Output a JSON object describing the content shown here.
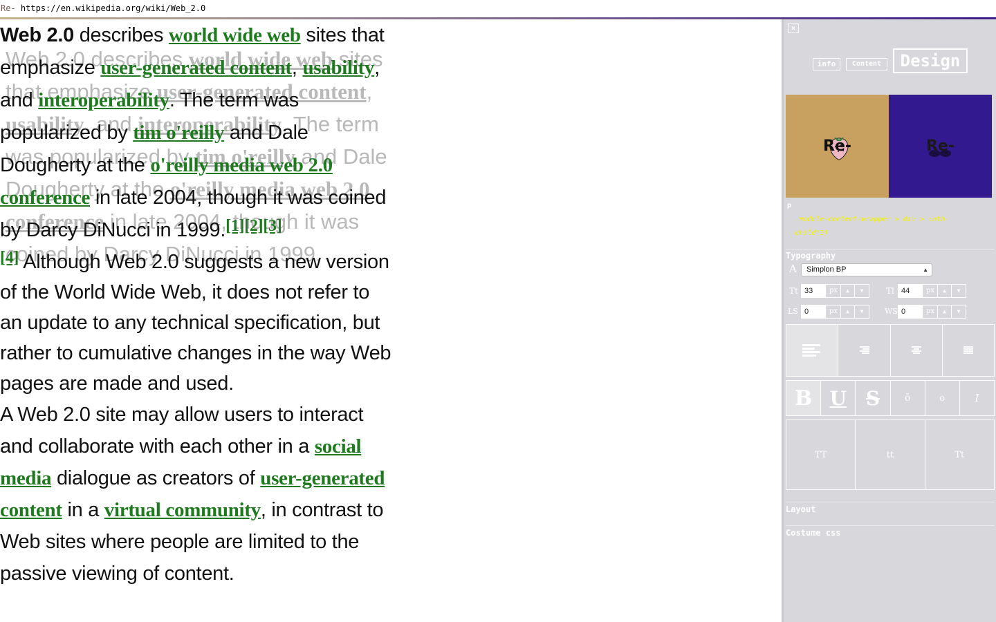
{
  "urlbar": {
    "logo": "Re-",
    "url": "https://en.wikipedia.org/wiki/Web_2.0"
  },
  "article": {
    "p1": {
      "title": "Web 2.0",
      "t1": " describes ",
      "l1": "world wide web",
      "t2": " sites that emphasize ",
      "l2": "user-generated content",
      "t3": ", ",
      "l3": "usability",
      "t4": ", and ",
      "l4": "interoperability",
      "t5": ". The term was popularized by ",
      "l5": "tim o'reilly",
      "t6": " and Dale Dougherty at the ",
      "l6": "o'reilly media web 2.0 conference",
      "t7": " in late 2004, though it was coined by Darcy DiNucci in 1999.",
      "ref1": "[1]",
      "ref2": "[2]",
      "ref3": "[3]",
      "ref4": "[4]",
      "t8": " Although Web 2.0 suggests a new version of the World Wide Web, it does not refer to an update to any technical specification, but rather to cumulative changes in the way Web pages are made and used."
    },
    "p2": {
      "t1": "A Web 2.0 site may allow users to interact and collaborate with each other in a ",
      "l1": "social media",
      "t2": " dialogue as creators of ",
      "l2": "user-generated content",
      "t3": " in a ",
      "l3": "virtual community",
      "t4": ", in contrast to Web sites where people are limited to the passive viewing of content."
    }
  },
  "panel": {
    "close_label": "×",
    "tabs": {
      "info": "info",
      "content": "Content",
      "design": "Design"
    },
    "preview": {
      "a_label": "Re-",
      "b_label": "Re-"
    },
    "selector": {
      "tag": "p",
      "path": ".module-content-wrapper > div > :nth-child(3)"
    },
    "typography": {
      "label": "Typography",
      "font_icon": "A",
      "font_value": "Simplon BP",
      "size": {
        "label": "Tt",
        "value": "33",
        "unit": "px"
      },
      "line_height": {
        "label": "Tl",
        "value": "44",
        "unit": "px"
      },
      "letter_spacing": {
        "label": "LS",
        "value": "0",
        "unit": "px"
      },
      "word_spacing": {
        "label": "WS",
        "value": "0",
        "unit": "px"
      },
      "style_buttons": {
        "bold": "B",
        "underline": "U",
        "strike": "S",
        "overline": "ō",
        "normal": "o",
        "italic": "I"
      },
      "case_buttons": {
        "upper": "TT",
        "lower": "tt",
        "capitalize": "Tt"
      }
    },
    "layout_label": "Layout",
    "costume_label": "Costume css",
    "colors": {
      "preview_a": "#c8a060",
      "preview_b": "#33198f",
      "link": "#1f7a1f",
      "selector": "#f0f000"
    }
  }
}
